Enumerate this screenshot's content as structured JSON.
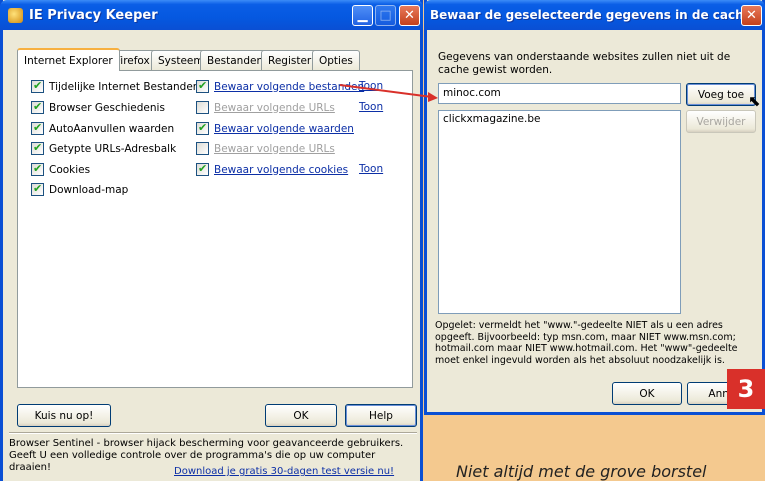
{
  "left_window": {
    "title": "IE Privacy Keeper",
    "tabs": [
      "Internet Explorer",
      "Firefox",
      "Systeem",
      "Bestanden",
      "Register",
      "Opties"
    ],
    "left_options": [
      {
        "label": "Tijdelijke Internet Bestanden",
        "checked": true
      },
      {
        "label": "Browser Geschiedenis",
        "checked": true
      },
      {
        "label": "AutoAanvullen waarden",
        "checked": true
      },
      {
        "label": "Getypte URLs-Adresbalk",
        "checked": true
      },
      {
        "label": "Cookies",
        "checked": true
      },
      {
        "label": "Download-map",
        "checked": true
      }
    ],
    "right_options": [
      {
        "label": "Bewaar volgende bestanden",
        "checked": true,
        "show": "Toon",
        "enabled": true
      },
      {
        "label": "Bewaar volgende URLs",
        "checked": false,
        "show": "Toon",
        "enabled": false
      },
      {
        "label": "Bewaar volgende waarden",
        "checked": true,
        "show": "",
        "enabled": true
      },
      {
        "label": "Bewaar volgende URLs",
        "checked": false,
        "show": "",
        "enabled": false
      },
      {
        "label": "Bewaar volgende cookies",
        "checked": true,
        "show": "Toon",
        "enabled": true
      }
    ],
    "kuis_button": "Kuis nu op!",
    "ok_button": "OK",
    "help_button": "Help",
    "footer_text": "Browser Sentinel - browser hijack bescherming voor geavanceerde gebruikers. Geeft U een volledige controle over de programma's die op uw computer draaien!",
    "footer_link": "Download je gratis 30-dagen test versie nu!"
  },
  "right_window": {
    "title": "Bewaar de geselecteerde gegevens in de cache",
    "description": "Gegevens van onderstaande websites zullen niet uit de cache gewist worden.",
    "input_value": "minoc.com",
    "add_button": "Voeg toe",
    "remove_button": "Verwijder",
    "list_items": [
      "clickxmagazine.be"
    ],
    "note": "Opgelet: vermeldt het \"www.\"-gedeelte NIET als u een adres opgeeft. Bijvoorbeeld: typ msn.com, maar NIET www.msn.com; hotmail.com maar NIET www.hotmail.com. Het \"www\"-gedeelte moet enkel ingevuld worden als het absoluut noodzakelijk is.",
    "ok_button": "OK",
    "cancel_button": "Annu"
  },
  "step_badge": "3",
  "caption": "Niet altijd met de grove borstel",
  "colors": {
    "badge": "#d9302a",
    "background": "#f4c98f",
    "arrow": "#d9302a"
  }
}
